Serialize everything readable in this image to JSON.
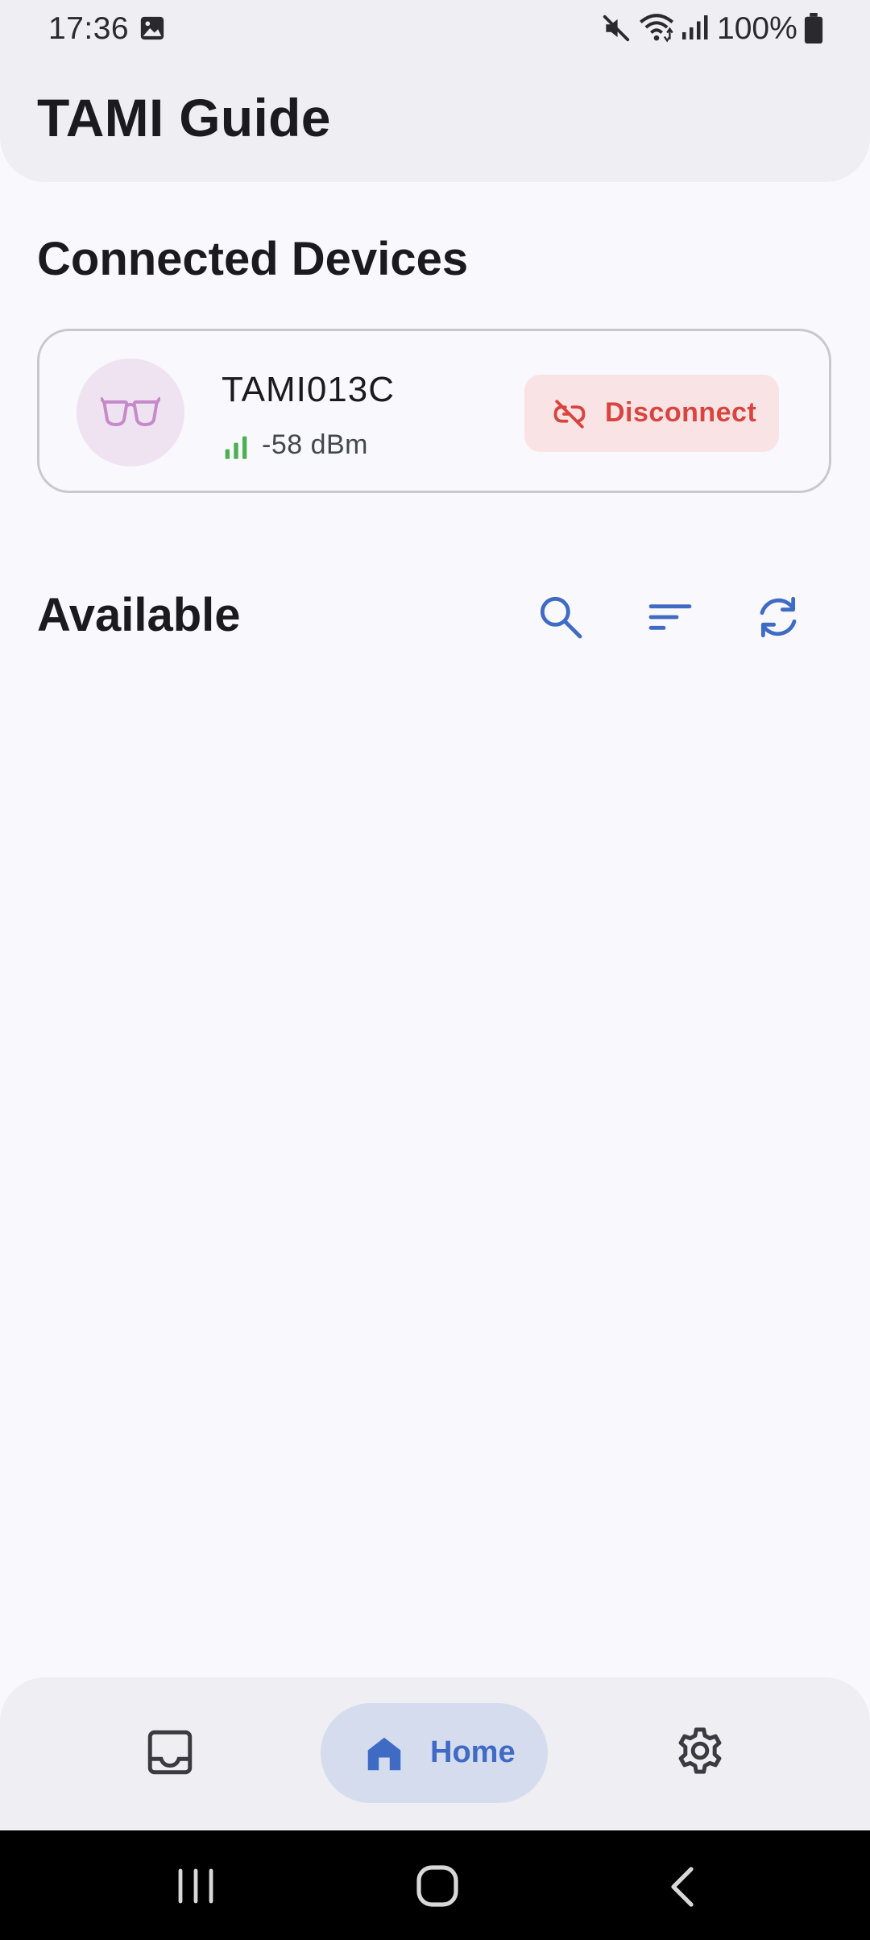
{
  "status_bar": {
    "time": "17:36",
    "battery": "100%",
    "icons": [
      "gallery-icon",
      "mute-icon",
      "wifi-icon",
      "signal-icon",
      "battery-icon"
    ]
  },
  "app_bar": {
    "title": "TAMI Guide"
  },
  "connected_section": {
    "title": "Connected Devices",
    "devices": [
      {
        "name": "TAMI013C",
        "rssi": "-58 dBm",
        "icon": "glasses-icon",
        "action_label": "Disconnect",
        "action_icon": "link-off-icon"
      }
    ]
  },
  "available_section": {
    "title": "Available",
    "actions": [
      "search-icon",
      "sort-icon",
      "refresh-icon"
    ]
  },
  "bottom_nav": {
    "items": [
      {
        "icon": "inbox-icon",
        "label": ""
      },
      {
        "icon": "home-icon",
        "label": "Home",
        "selected": true
      },
      {
        "icon": "gear-icon",
        "label": ""
      }
    ]
  },
  "colors": {
    "primary": "#3F6BC4",
    "danger": "#D9443E",
    "danger_container": "#F9E3E4",
    "signal_good": "#4CAF50",
    "avatar_bg": "#EFE3F2",
    "avatar_icon": "#C58AC9",
    "surface": "#F8F8FD",
    "surface_container": "#EEEEF3"
  }
}
